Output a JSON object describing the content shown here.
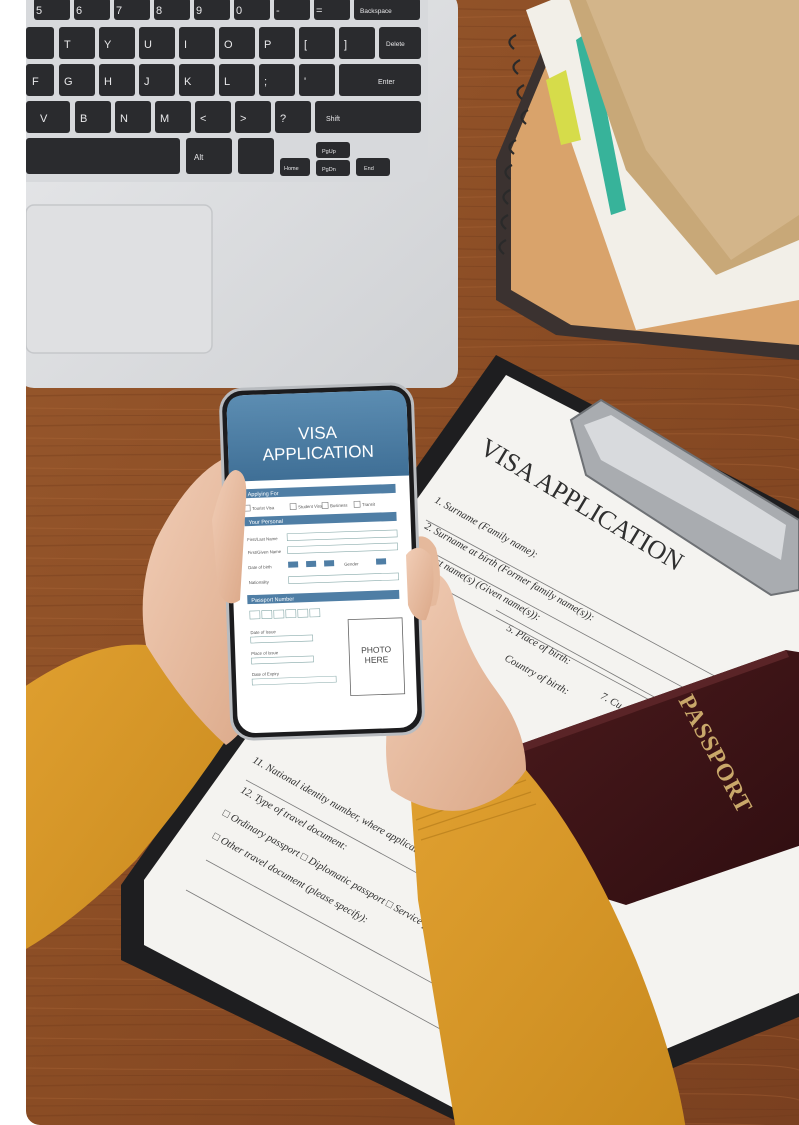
{
  "photo": {
    "keyboard_keys": {
      "backspace": "Backspace",
      "delete": "Delete",
      "enter": "Enter",
      "shift": "Shift",
      "alt": "Alt",
      "home": "Home",
      "end": "End",
      "pgup": "PgUp",
      "pgdn": "PgDn",
      "row1": [
        "5",
        "6",
        "7",
        "8",
        "9",
        "0",
        "-",
        "="
      ],
      "row2": [
        "T",
        "Y",
        "U",
        "I",
        "O",
        "P",
        "[",
        "]"
      ],
      "row3": [
        "F",
        "G",
        "H",
        "J",
        "K",
        "L",
        ";",
        "'"
      ],
      "row4": [
        "V",
        "B",
        "N",
        "M",
        "<",
        ">",
        "?"
      ]
    },
    "phone": {
      "title_line1": "VISA",
      "title_line2": "APPLICATION",
      "section_applying_for": "Applying For",
      "options": [
        "Tourist Visa",
        "Student Visa",
        "Business",
        "Transit"
      ],
      "section_personal": "Your Personal",
      "field_last_name": "First/Last Name",
      "field_first_name": "First/Given Name",
      "field_dob": "Date of birth",
      "field_nationality": "Nationality",
      "field_gender": "Gender",
      "section_passport": "Passport Number",
      "field_date_issue": "Date of Issue",
      "field_place_issue": "Place of Issue",
      "field_expiry": "Date of Expiry",
      "photo_box_line1": "PHOTO",
      "photo_box_line2": "HERE"
    },
    "paper_form": {
      "title": "VISA APPLICATION",
      "lines": [
        "1. Surname (Family name):",
        "2. Surname at birth (Former family name(s)):",
        "3. First name(s) (Given name(s)):",
        "5. Place of birth:",
        "Country of birth:",
        "7. Cu",
        "11. National identity number, where applicable:",
        "12. Type of travel document:",
        "□ Ordinary passport □ Diplomatic passport □ Service passport",
        "□ Other travel document (please specify):"
      ]
    },
    "passport": {
      "label": "PASSPORT"
    }
  }
}
